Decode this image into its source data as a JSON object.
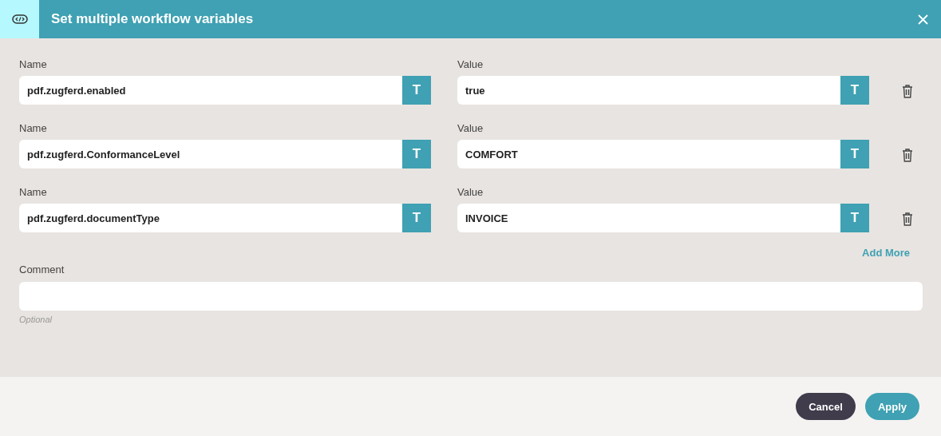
{
  "dialog": {
    "title": "Set multiple workflow variables"
  },
  "variables": [
    {
      "name_label": "Name",
      "name": "pdf.zugferd.enabled",
      "name_type_button": "T",
      "value_label": "Value",
      "value": "true",
      "value_type_button": "T"
    },
    {
      "name_label": "Name",
      "name": "pdf.zugferd.ConformanceLevel",
      "name_type_button": "T",
      "value_label": "Value",
      "value": "COMFORT",
      "value_type_button": "T"
    },
    {
      "name_label": "Name",
      "name": "pdf.zugferd.documentType",
      "name_type_button": "T",
      "value_label": "Value",
      "value": "INVOICE",
      "value_type_button": "T"
    }
  ],
  "add_more": "Add More",
  "comment": {
    "label": "Comment",
    "hint": "Optional"
  },
  "buttons": [
    {
      "label": "Cancel",
      "kind": "secondary"
    },
    {
      "label": "Apply",
      "kind": "primary"
    }
  ]
}
